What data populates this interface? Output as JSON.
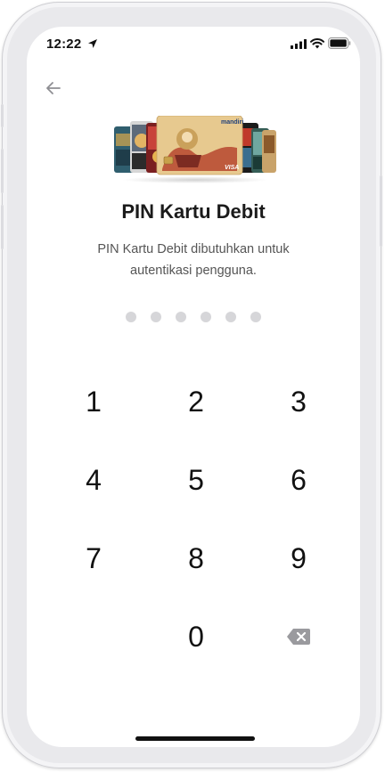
{
  "status_bar": {
    "time": "12:22"
  },
  "header": {
    "back_icon": "arrow-left-icon"
  },
  "illustration": {
    "brand": "mandiri",
    "network": "VISA"
  },
  "content": {
    "title": "PIN Kartu Debit",
    "subtitle": "PIN Kartu Debit dibutuhkan untuk autentikasi pengguna."
  },
  "pin": {
    "length": 6,
    "entered": 0
  },
  "keypad": {
    "keys": [
      "1",
      "2",
      "3",
      "4",
      "5",
      "6",
      "7",
      "8",
      "9",
      "0"
    ],
    "backspace_icon": "backspace-icon"
  },
  "colors": {
    "dot_empty": "#d6d6d9",
    "text_primary": "#1b1b1b",
    "text_secondary": "#555555"
  }
}
